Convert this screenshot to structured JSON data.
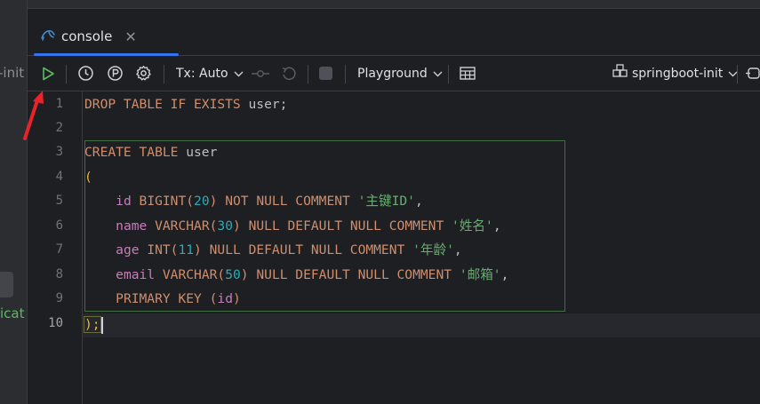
{
  "left_panel": {
    "fragment_top": "-init",
    "fragment_bottom": "icat"
  },
  "tab": {
    "label": "console",
    "icon": "mysql-dolphin-icon",
    "close_icon": "close-icon"
  },
  "toolbar": {
    "run_icon": "play-icon",
    "history_icon": "clock-icon",
    "parking_icon": "p-circle-icon",
    "settings_icon": "gear-icon",
    "tx_label": "Tx: Auto",
    "playground_label": "Playground",
    "datasource_label": "springboot-init"
  },
  "editor": {
    "line_numbers": [
      "1",
      "2",
      "3",
      "4",
      "5",
      "6",
      "7",
      "8",
      "9",
      "10"
    ],
    "active_line": 10,
    "code": {
      "l1_kw": "DROP TABLE IF EXISTS",
      "l1_id": " user;",
      "l3_kw": "CREATE TABLE",
      "l3_id": " user",
      "l4": "(",
      "l5_col": "id",
      "l5_type": "BIGINT",
      "l5_num": "20",
      "l5_kw": "NOT NULL COMMENT",
      "l5_str": "'主键ID'",
      "l6_col": "name",
      "l6_type": "VARCHAR",
      "l6_num": "30",
      "l6_kw": "NULL DEFAULT NULL COMMENT",
      "l6_str": "'姓名'",
      "l7_col": "age",
      "l7_type": "INT",
      "l7_num": "11",
      "l7_kw": "NULL DEFAULT NULL COMMENT",
      "l7_str": "'年龄'",
      "l8_col": "email",
      "l8_type": "VARCHAR",
      "l8_num": "50",
      "l8_kw": "NULL DEFAULT NULL COMMENT",
      "l8_str": "'邮箱'",
      "l9_kw": "PRIMARY KEY",
      "l9_col": "id",
      "l10": ");"
    }
  },
  "colors": {
    "accent": "#3574f0",
    "run_green": "#5fb865",
    "keyword": "#cf8e6d",
    "number": "#2aacb8",
    "string": "#6aab73",
    "column": "#c77dbb",
    "annotation_arrow": "#e8232a"
  }
}
